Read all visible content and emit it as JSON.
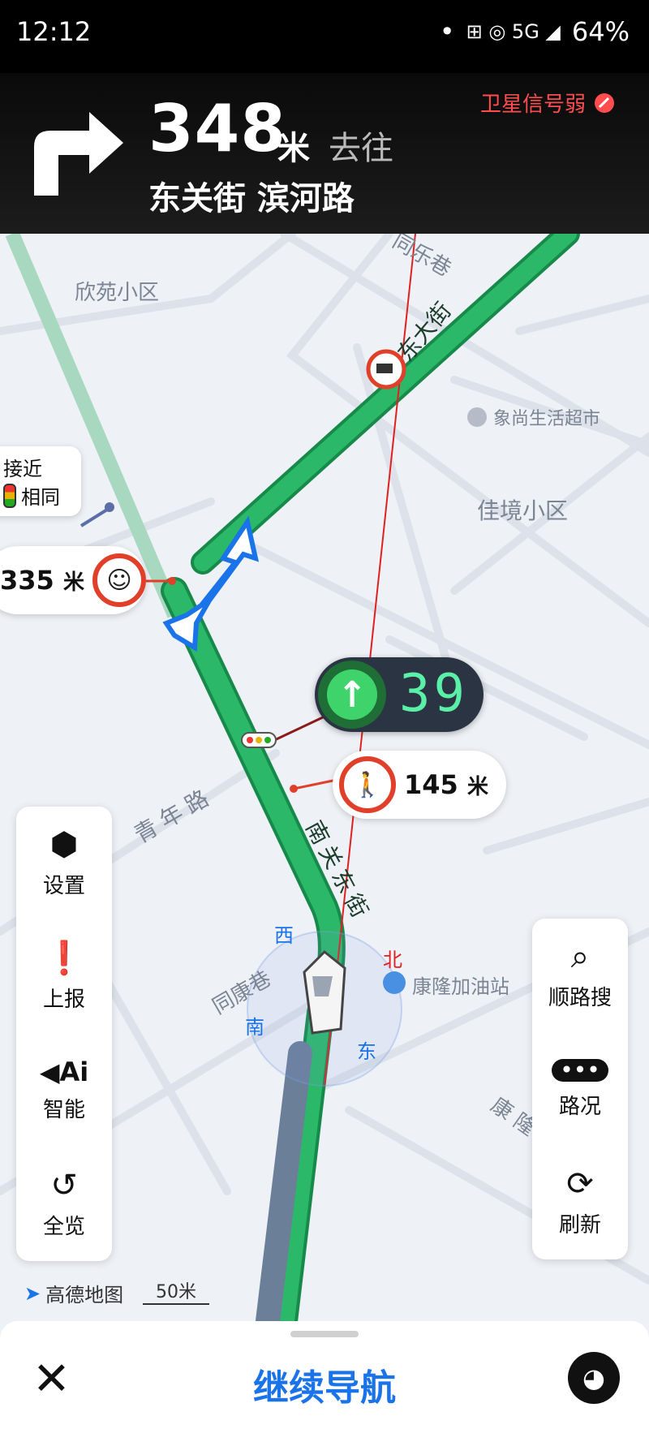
{
  "status_bar": {
    "time": "12:12",
    "dot": "•",
    "icons_text": "⊞ ◎ 5G ◢",
    "battery": "64%"
  },
  "nav_header": {
    "distance": "348",
    "distance_unit": "米",
    "goto": "去往",
    "road": "东关街 滨河路",
    "gps_warning": "卫星信号弱"
  },
  "map": {
    "labels": {
      "xinyuan": "欣苑小区",
      "tongle": "同乐巷",
      "dongdajie": "东大街",
      "market": "象尚生活超市",
      "jiajing": "佳境小区",
      "qingnian": "青年路",
      "nanguan": "南关东街",
      "tongkang": "同康巷",
      "kanglongjiayou": "康隆加油站",
      "kanglongxiang": "康隆巷"
    },
    "compass": {
      "west": "西",
      "north": "北",
      "south": "南",
      "east": "东"
    },
    "approach_tag": {
      "line1": "接近",
      "line2": "相同"
    },
    "seatbelt_tag": {
      "distance": "335",
      "unit": "米"
    },
    "crosswalk_tag": {
      "distance": "145",
      "unit": "米"
    },
    "traffic_light": {
      "countdown": "39"
    },
    "brand": "高德地图",
    "scale": "50米"
  },
  "left_panel": {
    "settings": "设置",
    "report": "上报",
    "smart": "智能",
    "overview": "全览"
  },
  "right_panel": {
    "search": "顺路搜",
    "traffic": "路况",
    "refresh": "刷新"
  },
  "bottom_bar": {
    "continue": "继续导航"
  },
  "colors": {
    "route_green": "#22a45a",
    "accent_blue": "#1a73e8",
    "warning_red": "#ff4d4f"
  }
}
